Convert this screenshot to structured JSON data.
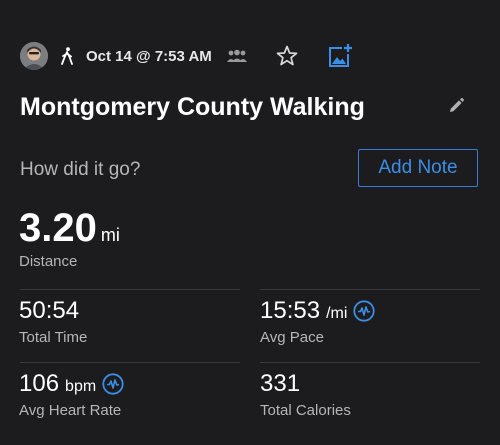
{
  "header": {
    "date": "Oct 14 @ 7:53 AM",
    "icons": [
      "avatar",
      "walking-icon",
      "group-icon",
      "star-icon",
      "add-photo-icon"
    ]
  },
  "activity": {
    "title": "Montgomery County Walking"
  },
  "note": {
    "prompt": "How did it go?",
    "button_label": "Add Note"
  },
  "distance": {
    "value": "3.20",
    "unit": "mi",
    "label": "Distance"
  },
  "stats": {
    "total_time": {
      "value": "50:54",
      "label": "Total Time"
    },
    "avg_pace": {
      "value": "15:53",
      "unit": "/mi",
      "label": "Avg Pace"
    },
    "avg_heart_rate": {
      "value": "106",
      "unit": "bpm",
      "label": "Avg Heart Rate"
    },
    "total_calories": {
      "value": "331",
      "label": "Total Calories"
    }
  },
  "colors": {
    "background": "#1c1c1e",
    "accent": "#3a8ee6",
    "secondary_text": "#b6b6ba",
    "divider": "#3a3a3d"
  }
}
